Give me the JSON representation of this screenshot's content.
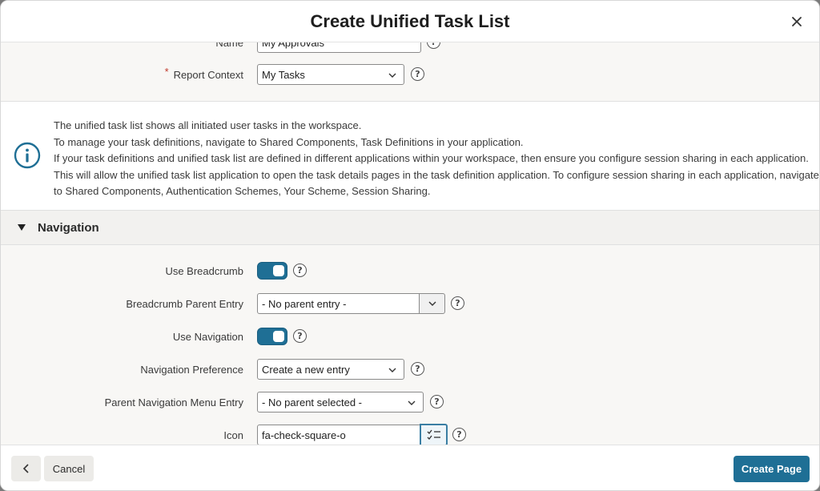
{
  "dialog": {
    "title": "Create Unified Task List",
    "close_icon": "close-icon"
  },
  "fields": {
    "name": {
      "label": "Name",
      "value": "My Approvals"
    },
    "report_context": {
      "label": "Report Context",
      "value": "My Tasks",
      "required": true
    }
  },
  "info": {
    "icon": "info-circle-icon",
    "lines": [
      "The unified task list shows all initiated user tasks in the workspace.",
      "To manage your task definitions, navigate to Shared Components, Task Definitions in your application.",
      "If your task definitions and unified task list are defined in different applications within your workspace, then ensure you configure session sharing in each application.",
      "This will allow the unified task list application to open the task details pages in the task definition application. To configure session sharing in each application, navigate",
      "to Shared Components, Authentication Schemes, Your Scheme, Session Sharing."
    ]
  },
  "navigation": {
    "section_title": "Navigation",
    "use_breadcrumb": {
      "label": "Use Breadcrumb",
      "on": true
    },
    "breadcrumb_parent": {
      "label": "Breadcrumb Parent Entry",
      "value": "- No parent entry -"
    },
    "use_navigation": {
      "label": "Use Navigation",
      "on": true
    },
    "navigation_preference": {
      "label": "Navigation Preference",
      "value": "Create a new entry"
    },
    "parent_menu_entry": {
      "label": "Parent Navigation Menu Entry",
      "value": "- No parent selected -"
    },
    "icon": {
      "label": "Icon",
      "value": "fa-check-square-o"
    }
  },
  "footer": {
    "cancel_label": "Cancel",
    "create_label": "Create Page"
  },
  "colors": {
    "accent": "#1f6f95",
    "required": "#c0392b"
  }
}
